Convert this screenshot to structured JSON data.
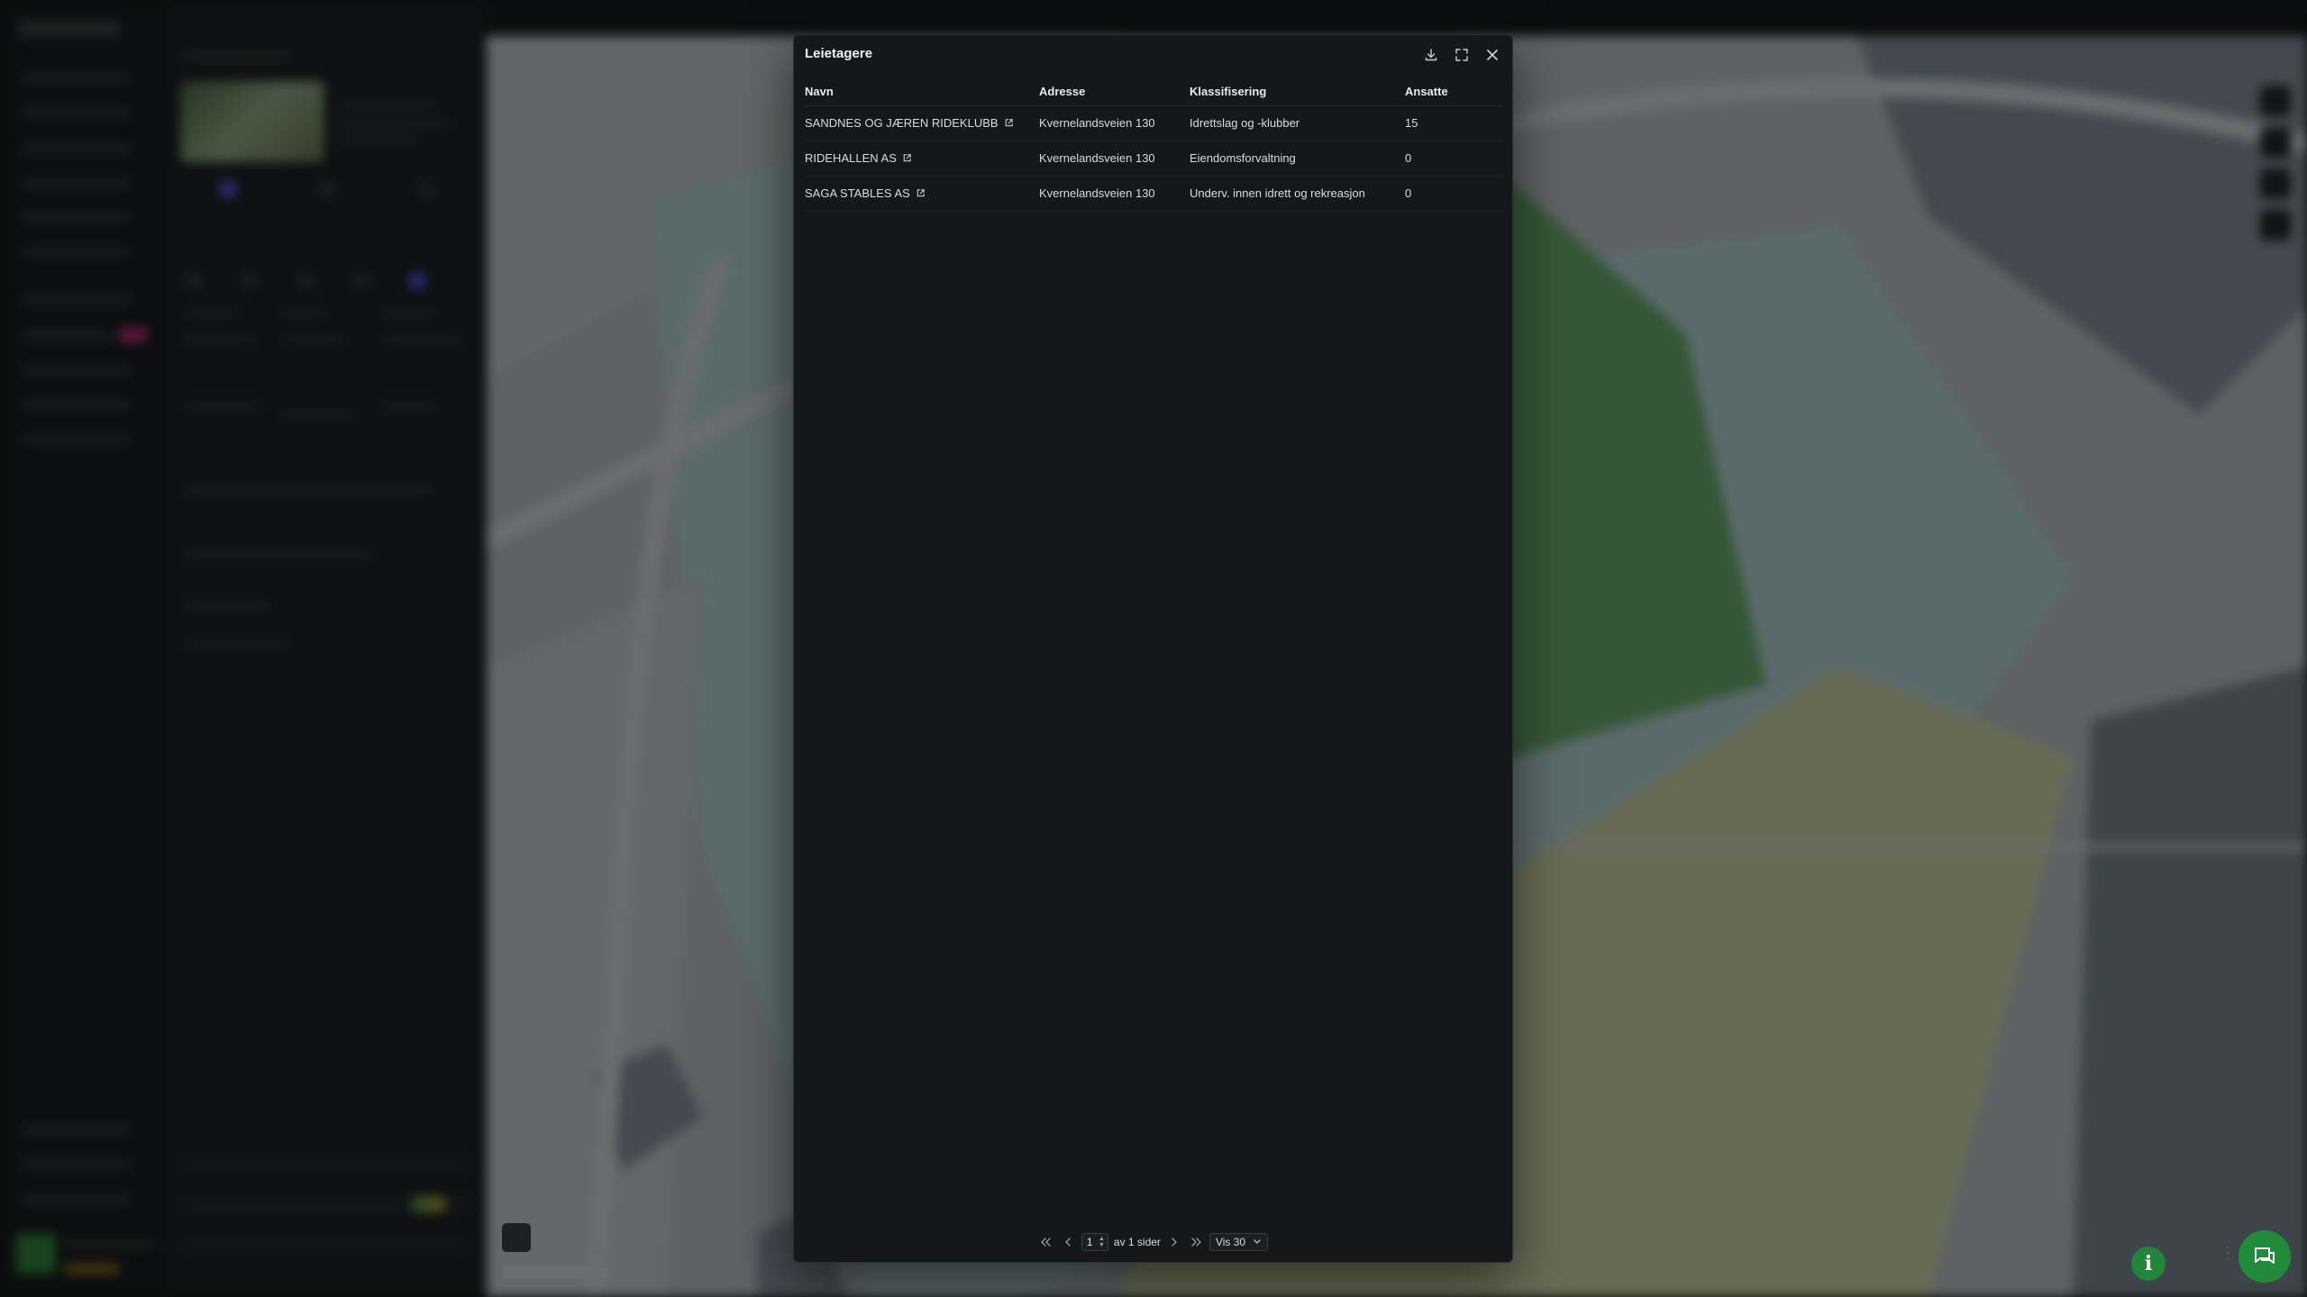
{
  "modal": {
    "title": "Leietagere",
    "actions": [
      {
        "name": "download-icon"
      },
      {
        "name": "expand-icon"
      },
      {
        "name": "close-icon"
      }
    ]
  },
  "table": {
    "headers": {
      "name": "Navn",
      "address": "Adresse",
      "classification": "Klassifisering",
      "employees": "Ansatte"
    },
    "rows": [
      {
        "name": "SANDNES OG JÆREN RIDEKLUBB",
        "address": "Kvernelandsveien 130",
        "classification": "Idrettslag og -klubber",
        "employees": "15"
      },
      {
        "name": "RIDEHALLEN AS",
        "address": "Kvernelandsveien 130",
        "classification": "Eiendomsforvaltning",
        "employees": "0"
      },
      {
        "name": "SAGA STABLES AS",
        "address": "Kvernelandsveien 130",
        "classification": "Underv. innen idrett og rekreasjon",
        "employees": "0"
      }
    ]
  },
  "pagination": {
    "current_page": "1",
    "total_text": "av 1 sider",
    "page_size": "Vis 30"
  },
  "colors": {
    "accent_green": "#23843a",
    "badge_pink": "#c0287a",
    "map_green": "#6fb56f"
  }
}
